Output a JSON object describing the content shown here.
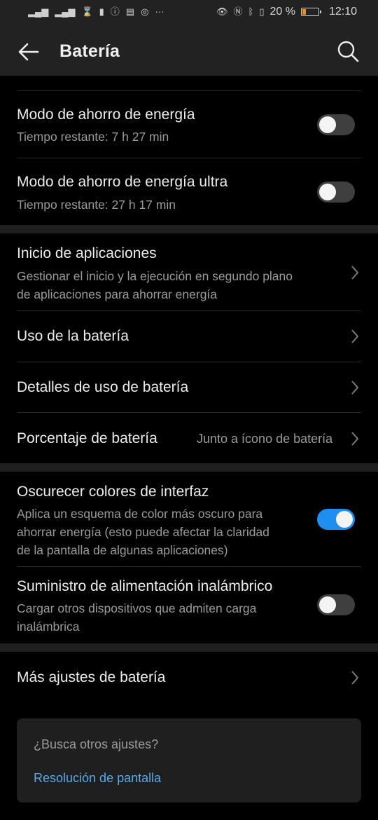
{
  "status_bar": {
    "battery_percent": "20 %",
    "battery_level": 0.2,
    "time": "12:10",
    "left_icons": [
      "signal-x-icon",
      "signal-icon",
      "hourglass-icon",
      "battery-saver-icon",
      "alert-icon",
      "news-icon",
      "instagram-icon",
      "more-dots-icon"
    ],
    "right_icons": [
      "eye-icon",
      "nfc-icon",
      "bluetooth-icon",
      "vibrate-icon",
      "battery-icon"
    ]
  },
  "header": {
    "title": "Batería"
  },
  "power_saving": {
    "label": "Modo de ahorro de energía",
    "sub": "Tiempo restante: 7 h 27 min",
    "enabled": false
  },
  "ultra_saving": {
    "label": "Modo de ahorro de energía ultra",
    "sub": "Tiempo restante: 27 h 17 min",
    "enabled": false
  },
  "app_launch": {
    "label": "Inicio de aplicaciones",
    "sub_line1": "Gestionar el inicio y la ejecución en segundo plano",
    "sub_line2": "de aplicaciones para ahorrar energía"
  },
  "battery_usage": {
    "label": "Uso de la batería"
  },
  "usage_details": {
    "label": "Detalles de uso de batería"
  },
  "battery_percentage": {
    "label": "Porcentaje de batería",
    "value": "Junto a ícono de batería"
  },
  "dark_colors": {
    "label": "Oscurecer colores de interfaz",
    "sub_line1": "Aplica un esquema de color más oscuro para",
    "sub_line2": "ahorrar energía (esto puede afectar la claridad",
    "sub_line3": "de la pantalla de algunas aplicaciones)",
    "enabled": true
  },
  "wireless_supply": {
    "label": "Suministro de alimentación inalámbrico",
    "sub_line1": "Cargar otros dispositivos que admiten carga",
    "sub_line2": "inalámbrica",
    "enabled": false
  },
  "more_settings": {
    "label": "Más ajustes de batería"
  },
  "suggestion": {
    "question": "¿Busca otros ajustes?",
    "link": "Resolución de pantalla"
  },
  "colors": {
    "accent": "#1e8ff0",
    "link": "#5aa9ea",
    "battery_low": "#f08a1d"
  }
}
